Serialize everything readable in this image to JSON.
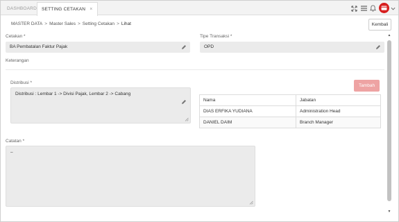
{
  "tabs": [
    {
      "label": "DASHBOARD"
    },
    {
      "label": "SETTING CETAKAN",
      "close": "×"
    }
  ],
  "breadcrumb": [
    "MASTER DATA",
    "Master Sales",
    "Setting Cetakan",
    "Lihat"
  ],
  "breadcrumb_separator": ">",
  "actions": {
    "kembali": "Kembali",
    "tambah": "Tambah"
  },
  "form": {
    "cetakan": {
      "label": "Cetakan *",
      "value": "BA Pembatalan Faktur Pajak"
    },
    "tipe_transaksi": {
      "label": "Tipe Transaksi *",
      "value": "OPD"
    },
    "keterangan": {
      "label": "Keterangan"
    },
    "distribusi": {
      "label": "Distribusi *",
      "value": "Distribusi : Lembar 1 -> Divisi Pajak, Lembar 2 -> Cabang"
    },
    "catatan": {
      "label": "Catatan *",
      "value": "–"
    }
  },
  "table": {
    "headers": [
      "Nama",
      "Jabatan"
    ],
    "rows": [
      [
        "DIAS ERFIKA YUDIANA",
        "Administration Head"
      ],
      [
        "DANIEL DAIM",
        "Branch Manager"
      ]
    ]
  },
  "icons": [
    "expand-icon",
    "menu-icon",
    "bell-icon",
    "user-avatar-icon",
    "chevron-down-icon",
    "pencil-icon",
    "resize-handle-icon"
  ],
  "colors": {
    "tambah_button": "#eea3a3",
    "avatar": "#d71f1f",
    "field_bg": "#ebebeb"
  }
}
